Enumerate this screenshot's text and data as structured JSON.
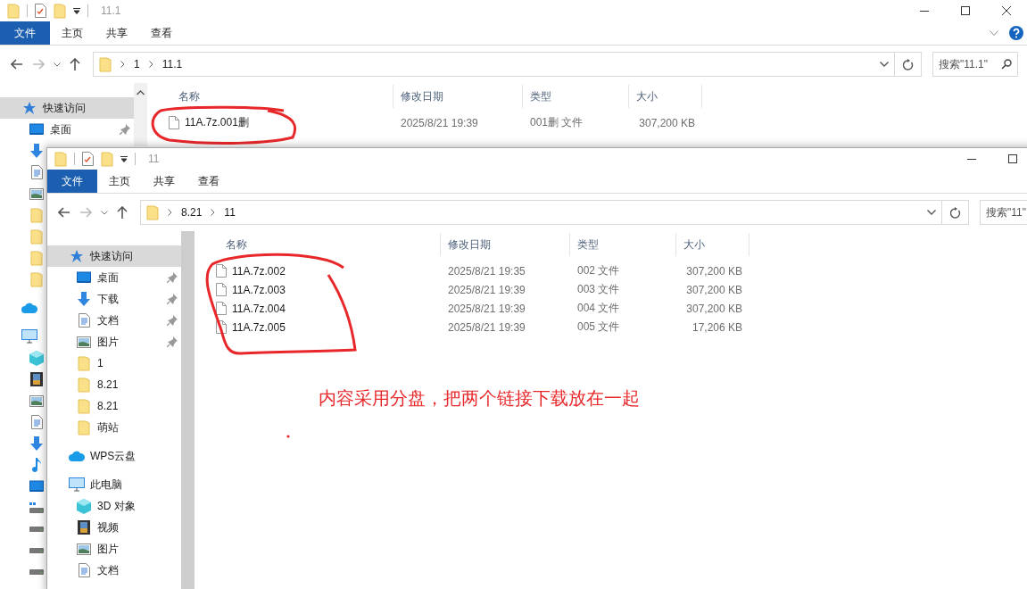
{
  "back_window": {
    "title": "11.1",
    "window_controls": [
      {
        "kind": "minimize"
      },
      {
        "kind": "maximize"
      },
      {
        "kind": "close"
      }
    ],
    "file_menu": "文件",
    "ribbon_tabs": [
      "主页",
      "共享",
      "查看"
    ],
    "ribbon_icons": [
      {
        "kind": "expand"
      },
      {
        "kind": "help"
      }
    ],
    "nav": {
      "back_enabled": true,
      "forward_enabled": false
    },
    "breadcrumb": [
      "1",
      "11.1"
    ],
    "search": {
      "placeholder": "搜索\"11.1\"",
      "icons": [
        {
          "kind": "search"
        }
      ]
    },
    "sidebar": [
      {
        "kind": "star",
        "label": "快速访问",
        "selected": true,
        "pinned": false
      },
      {
        "kind": "desktop",
        "label": "桌面",
        "selected": false,
        "pinned": true
      },
      {
        "kind": "download",
        "selected": false
      },
      {
        "kind": "document",
        "selected": false
      },
      {
        "kind": "pictures",
        "selected": false
      },
      {
        "kind": "folder",
        "selected": false
      },
      {
        "kind": "folder",
        "selected": false
      },
      {
        "kind": "folder",
        "selected": false
      },
      {
        "kind": "folder",
        "selected": false
      },
      {
        "kind": "cloud",
        "selected": false
      },
      {
        "kind": "pc",
        "selected": false
      },
      {
        "kind": "cube",
        "selected": false
      },
      {
        "kind": "video",
        "selected": false
      },
      {
        "kind": "pictures",
        "selected": false
      },
      {
        "kind": "document",
        "selected": false
      },
      {
        "kind": "download",
        "selected": false
      },
      {
        "kind": "music",
        "selected": false
      },
      {
        "kind": "desktop",
        "selected": false
      },
      {
        "kind": "system-drive",
        "selected": false
      },
      {
        "kind": "drive",
        "selected": false
      },
      {
        "kind": "drive",
        "selected": false
      },
      {
        "kind": "drive",
        "selected": false
      }
    ],
    "columns": [
      "名称",
      "修改日期",
      "类型",
      "大小"
    ],
    "files": [
      {
        "name": "11A.7z.001删",
        "modified": "2025/8/21 19:39",
        "type": "001删 文件",
        "size": "307,200 KB"
      }
    ]
  },
  "front_window": {
    "title": "11",
    "window_controls": [
      {
        "kind": "minimize"
      },
      {
        "kind": "maximize"
      }
    ],
    "file_menu": "文件",
    "ribbon_tabs": [
      "主页",
      "共享",
      "查看"
    ],
    "nav": {
      "back_enabled": true,
      "forward_enabled": false
    },
    "breadcrumb": [
      "8.21",
      "11"
    ],
    "search": {
      "placeholder": "搜索\"11\""
    },
    "sidebar": [
      {
        "kind": "star",
        "label": "快速访问",
        "selected": true,
        "pinned": false
      },
      {
        "kind": "desktop",
        "label": "桌面",
        "selected": false,
        "pinned": true
      },
      {
        "kind": "download",
        "label": "下载",
        "selected": false,
        "pinned": true
      },
      {
        "kind": "document",
        "label": "文档",
        "selected": false,
        "pinned": true
      },
      {
        "kind": "pictures",
        "label": "图片",
        "selected": false,
        "pinned": true
      },
      {
        "kind": "folder",
        "label": "1",
        "selected": false,
        "pinned": false
      },
      {
        "kind": "folder",
        "label": "8.21",
        "selected": false,
        "pinned": false
      },
      {
        "kind": "folder",
        "label": "8.21",
        "selected": false,
        "pinned": false
      },
      {
        "kind": "folder",
        "label": "萌站",
        "selected": false,
        "pinned": false
      },
      {
        "kind": "cloud",
        "label": "WPS云盘",
        "selected": false,
        "pinned": false
      },
      {
        "kind": "pc",
        "label": "此电脑",
        "selected": false,
        "pinned": false
      },
      {
        "kind": "cube",
        "label": "3D 对象",
        "selected": false,
        "pinned": false
      },
      {
        "kind": "video",
        "label": "视频",
        "selected": false,
        "pinned": false
      },
      {
        "kind": "pictures",
        "label": "图片",
        "selected": false,
        "pinned": false
      },
      {
        "kind": "document",
        "label": "文档",
        "selected": false,
        "pinned": false
      }
    ],
    "columns": [
      "名称",
      "修改日期",
      "类型",
      "大小"
    ],
    "files": [
      {
        "name": "11A.7z.002",
        "modified": "2025/8/21 19:35",
        "type": "002 文件",
        "size": "307,200 KB"
      },
      {
        "name": "11A.7z.003",
        "modified": "2025/8/21 19:39",
        "type": "003 文件",
        "size": "307,200 KB"
      },
      {
        "name": "11A.7z.004",
        "modified": "2025/8/21 19:39",
        "type": "004 文件",
        "size": "307,200 KB"
      },
      {
        "name": "11A.7z.005",
        "modified": "2025/8/21 19:39",
        "type": "005 文件",
        "size": "17,206 KB"
      }
    ]
  },
  "annotation": {
    "note": "内容采用分盘，把两个链接下载放在一起"
  }
}
